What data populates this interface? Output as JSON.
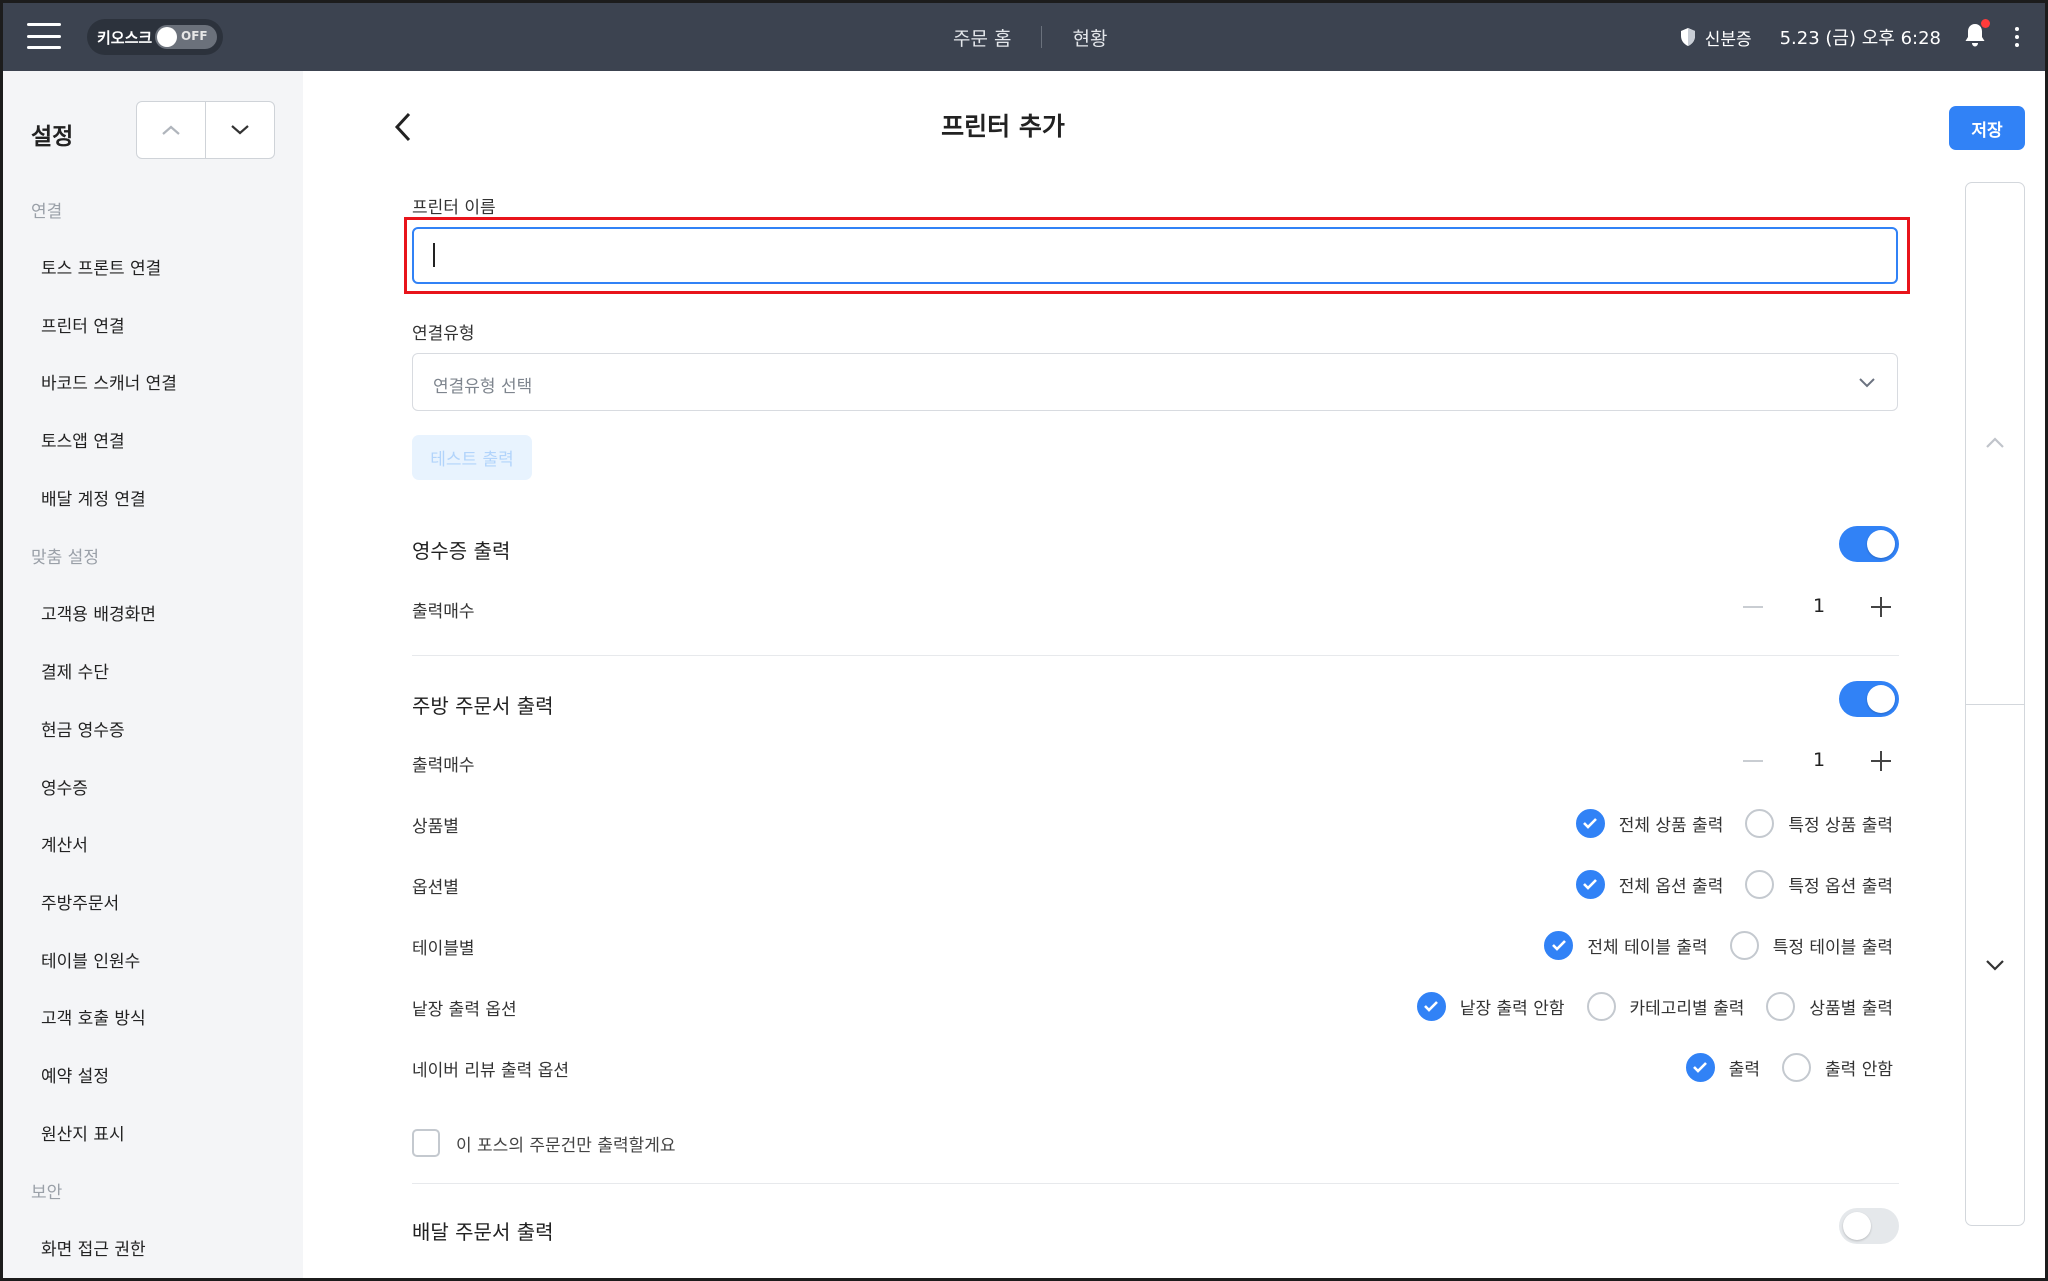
{
  "topbar": {
    "kiosk_label": "키오스크",
    "kiosk_state": "OFF",
    "tabs": [
      {
        "label": "주문 홈"
      },
      {
        "label": "현황"
      }
    ],
    "id_verify_label": "신분증",
    "datetime": "5.23 (금) 오후 6:28"
  },
  "sidebar": {
    "title": "설정",
    "sections": [
      {
        "title": "연결",
        "items": [
          "토스 프론트 연결",
          "프린터 연결",
          "바코드 스캐너 연결",
          "토스앱 연결",
          "배달 계정 연결"
        ]
      },
      {
        "title": "맞춤 설정",
        "items": [
          "고객용 배경화면",
          "결제 수단",
          "현금 영수증",
          "영수증",
          "계산서",
          "주방주문서",
          "테이블 인원수",
          "고객 호출 방식",
          "예약 설정",
          "원산지 표시"
        ]
      },
      {
        "title": "보안",
        "items": [
          "화면 접근 권한"
        ]
      }
    ]
  },
  "main": {
    "title": "프린터 추가",
    "save_label": "저장",
    "printer_name_label": "프린터 이름",
    "printer_name_value": "",
    "connection_type_label": "연결유형",
    "connection_type_placeholder": "연결유형 선택",
    "test_print_label": "테스트 출력",
    "receipt": {
      "title": "영수증 출력",
      "enabled": true,
      "copies_label": "출력매수",
      "copies": "1"
    },
    "kitchen": {
      "title": "주방 주문서 출력",
      "enabled": true,
      "copies_label": "출력매수",
      "copies": "1",
      "rows": [
        {
          "label": "상품별",
          "options": [
            {
              "label": "전체 상품 출력",
              "checked": true
            },
            {
              "label": "특정 상품 출력",
              "checked": false
            }
          ]
        },
        {
          "label": "옵션별",
          "options": [
            {
              "label": "전체 옵션 출력",
              "checked": true
            },
            {
              "label": "특정 옵션 출력",
              "checked": false
            }
          ]
        },
        {
          "label": "테이블별",
          "options": [
            {
              "label": "전체 테이블 출력",
              "checked": true
            },
            {
              "label": "특정 테이블 출력",
              "checked": false
            }
          ]
        },
        {
          "label": "낱장 출력 옵션",
          "options": [
            {
              "label": "낱장 출력 안함",
              "checked": true
            },
            {
              "label": "카테고리별 출력",
              "checked": false
            },
            {
              "label": "상품별 출력",
              "checked": false
            }
          ]
        },
        {
          "label": "네이버 리뷰 출력 옵션",
          "options": [
            {
              "label": "출력",
              "checked": true
            },
            {
              "label": "출력 안함",
              "checked": false
            }
          ]
        }
      ],
      "only_this_pos_label": "이 포스의 주문건만 출력할게요",
      "only_this_pos_checked": false
    },
    "delivery": {
      "title": "배달 주문서 출력",
      "enabled": false
    }
  },
  "colors": {
    "topbar": "#3c4350",
    "accent": "#3182f6",
    "highlight": "#e8141b",
    "sidebar_bg": "#f4f5f7"
  }
}
